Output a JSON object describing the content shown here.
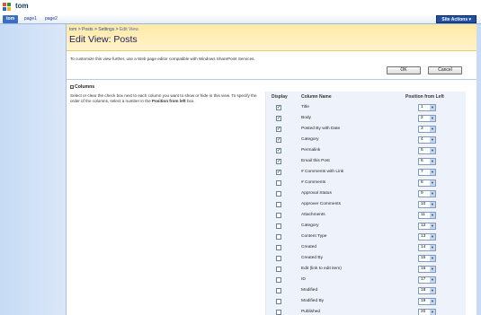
{
  "header": {
    "site_title": "tom"
  },
  "tabs": [
    {
      "label": "tom",
      "active": true
    },
    {
      "label": "page1",
      "active": false
    },
    {
      "label": "page2",
      "active": false
    }
  ],
  "site_actions": {
    "label": "Site Actions ▾"
  },
  "breadcrumb": {
    "items": [
      "tom",
      "Posts",
      "Settings",
      "Edit View"
    ],
    "separator": ">"
  },
  "page": {
    "title": "Edit View: Posts",
    "intro": "To customize this view further, use a Web page editor compatible with Windows SharePoint Services."
  },
  "buttons": {
    "ok": "OK",
    "cancel": "Cancel"
  },
  "columns_section": {
    "title": "Columns",
    "toggle": "-",
    "desc_before": "Select or clear the check box next to each column you want to show or hide in this view. To specify the order of the columns, select a number in the ",
    "desc_bold": "Position from left",
    "desc_after": " box."
  },
  "table_headers": {
    "display": "Display",
    "column_name": "Column Name",
    "position": "Position from Left"
  },
  "columns": [
    {
      "name": "Title",
      "checked": true,
      "position": "1"
    },
    {
      "name": "Body",
      "checked": true,
      "position": "2"
    },
    {
      "name": "Posted By with Date",
      "checked": true,
      "position": "3"
    },
    {
      "name": "Category",
      "checked": true,
      "position": "4"
    },
    {
      "name": "Permalink",
      "checked": true,
      "position": "5"
    },
    {
      "name": "Email this Post",
      "checked": true,
      "position": "6"
    },
    {
      "name": "# Comments with Link",
      "checked": true,
      "position": "7"
    },
    {
      "name": "# Comments",
      "checked": false,
      "position": "8"
    },
    {
      "name": "Approval Status",
      "checked": false,
      "position": "9"
    },
    {
      "name": "Approver Comments",
      "checked": false,
      "position": "10"
    },
    {
      "name": "Attachments",
      "checked": false,
      "position": "11"
    },
    {
      "name": "Category",
      "checked": false,
      "position": "12"
    },
    {
      "name": "Content Type",
      "checked": false,
      "position": "13"
    },
    {
      "name": "Created",
      "checked": false,
      "position": "14"
    },
    {
      "name": "Created By",
      "checked": false,
      "position": "15"
    },
    {
      "name": "Edit (link to edit item)",
      "checked": false,
      "position": "16"
    },
    {
      "name": "ID",
      "checked": false,
      "position": "17"
    },
    {
      "name": "Modified",
      "checked": false,
      "position": "18"
    },
    {
      "name": "Modified By",
      "checked": false,
      "position": "19"
    },
    {
      "name": "Published",
      "checked": false,
      "position": "20"
    }
  ]
}
